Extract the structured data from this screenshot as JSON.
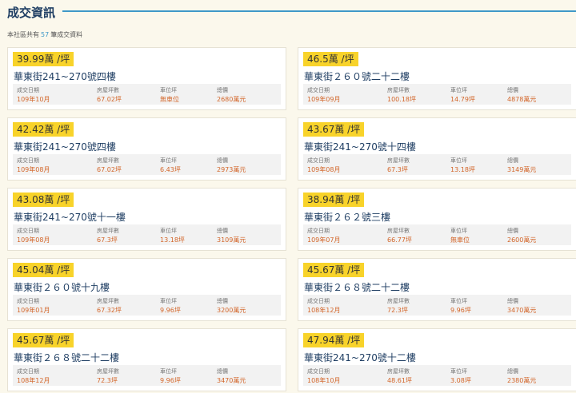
{
  "header": {
    "title": "成交資訊"
  },
  "summary": {
    "prefix": "本社區共有",
    "count": "57",
    "suffix": "筆成交資料"
  },
  "labels": {
    "date": "成交日期",
    "area": "房屋坪數",
    "parking": "車位坪",
    "total": "總價"
  },
  "colors": {
    "badge": "#f8d32a",
    "accent": "#3f98c8",
    "value": "#d3662a",
    "title": "#1f3e63"
  },
  "records": [
    {
      "price": "39.99萬 /坪",
      "address": "華東街241~270號四樓",
      "date": "109年10月",
      "area": "67.02坪",
      "parking": "無車位",
      "total": "2680萬元"
    },
    {
      "price": "46.5萬 /坪",
      "address": "華東街２６０號二十二樓",
      "date": "109年09月",
      "area": "100.18坪",
      "parking": "14.79坪",
      "total": "4878萬元"
    },
    {
      "price": "42.42萬 /坪",
      "address": "華東街241~270號四樓",
      "date": "109年08月",
      "area": "67.02坪",
      "parking": "6.43坪",
      "total": "2973萬元"
    },
    {
      "price": "43.67萬 /坪",
      "address": "華東街241~270號十四樓",
      "date": "109年08月",
      "area": "67.3坪",
      "parking": "13.18坪",
      "total": "3149萬元"
    },
    {
      "price": "43.08萬 /坪",
      "address": "華東街241~270號十一樓",
      "date": "109年08月",
      "area": "67.3坪",
      "parking": "13.18坪",
      "total": "3109萬元"
    },
    {
      "price": "38.94萬 /坪",
      "address": "華東街２６２號三樓",
      "date": "109年07月",
      "area": "66.77坪",
      "parking": "無車位",
      "total": "2600萬元"
    },
    {
      "price": "45.04萬 /坪",
      "address": "華東街２６０號十九樓",
      "date": "109年01月",
      "area": "67.32坪",
      "parking": "9.96坪",
      "total": "3200萬元"
    },
    {
      "price": "45.67萬 /坪",
      "address": "華東街２６８號二十二樓",
      "date": "108年12月",
      "area": "72.3坪",
      "parking": "9.96坪",
      "total": "3470萬元"
    },
    {
      "price": "45.67萬 /坪",
      "address": "華東街２６８號二十二樓",
      "date": "108年12月",
      "area": "72.3坪",
      "parking": "9.96坪",
      "total": "3470萬元"
    },
    {
      "price": "47.94萬 /坪",
      "address": "華東街241~270號十二樓",
      "date": "108年10月",
      "area": "48.61坪",
      "parking": "3.08坪",
      "total": "2380萬元"
    }
  ]
}
